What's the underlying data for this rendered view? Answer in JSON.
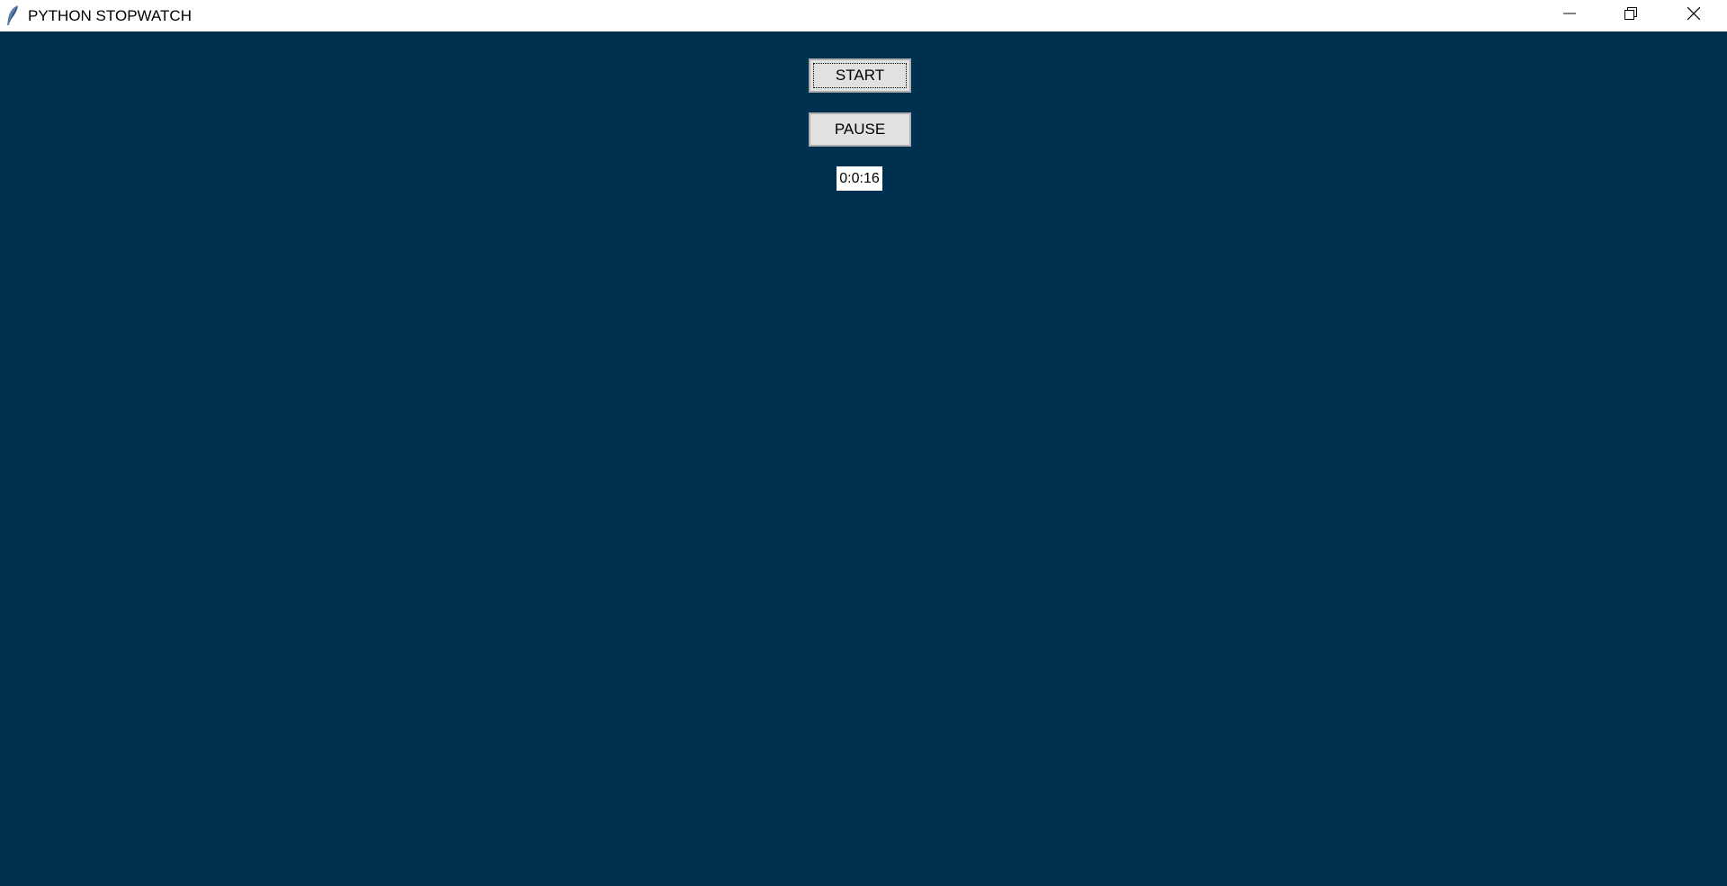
{
  "window": {
    "title": "PYTHON STOPWATCH",
    "background_color": "#00304f"
  },
  "titlebar": {
    "app_icon": "feather-icon",
    "minimize_icon": "minimize-icon",
    "maximize_icon": "restore-icon",
    "close_icon": "close-icon"
  },
  "controls": {
    "start_label": "START",
    "pause_label": "PAUSE"
  },
  "display": {
    "elapsed_time": "0:0:16"
  }
}
